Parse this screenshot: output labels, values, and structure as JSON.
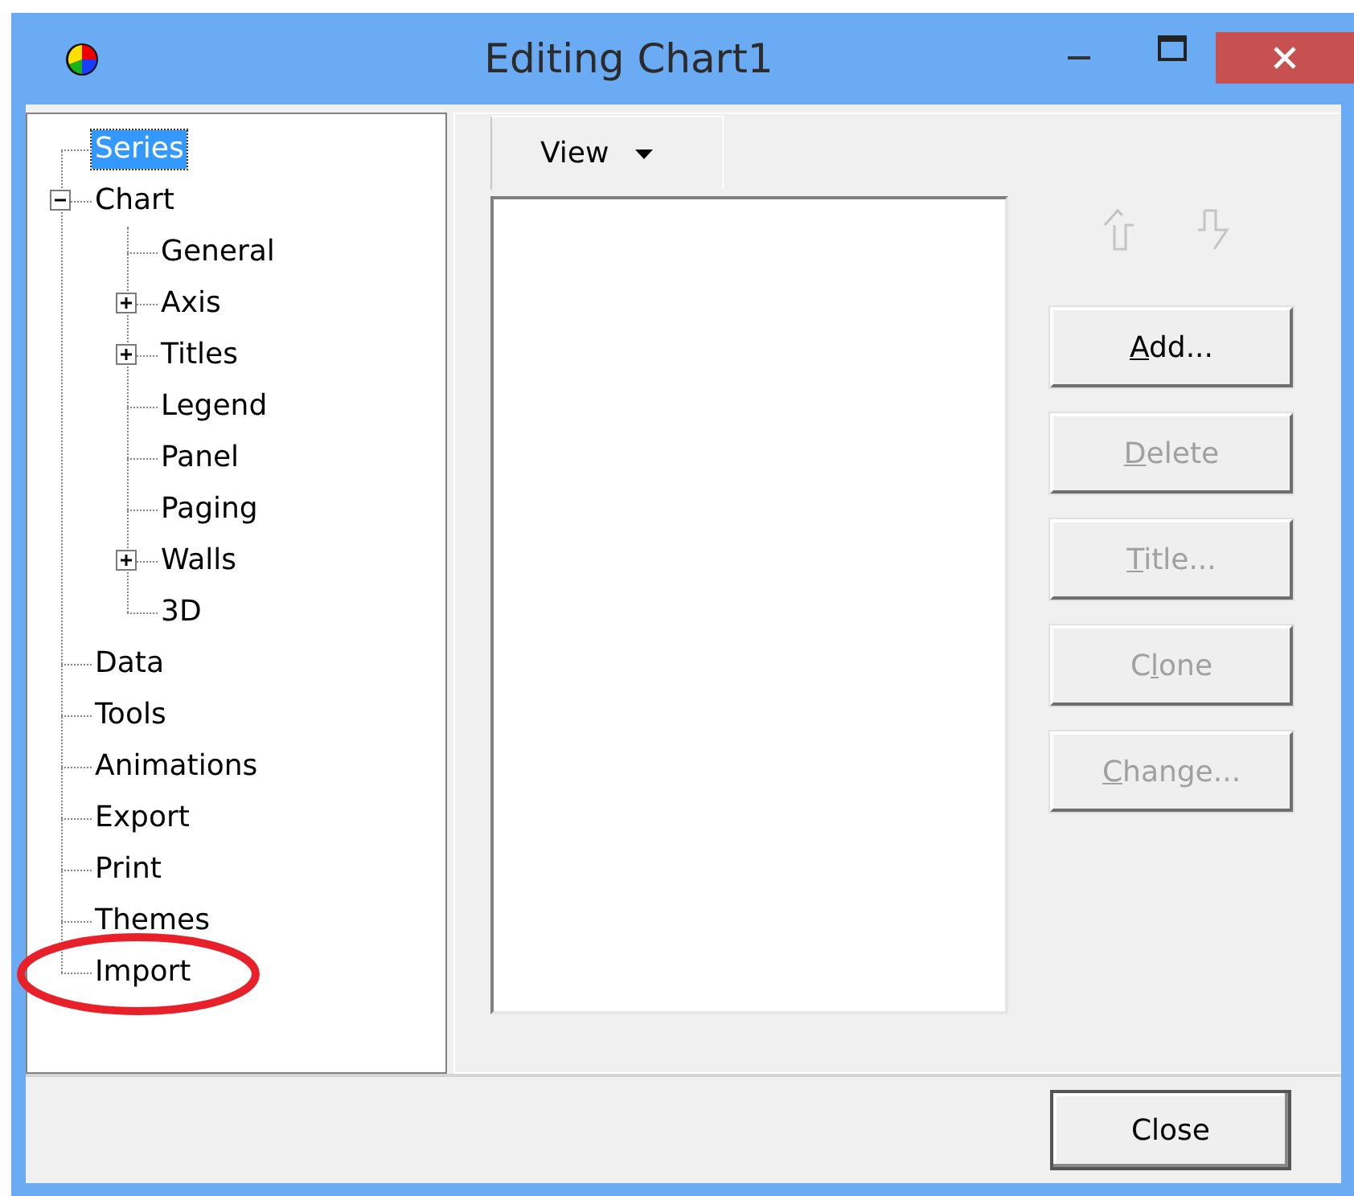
{
  "window": {
    "title": "Editing Chart1"
  },
  "tree": {
    "items": [
      {
        "label": "Series",
        "kind": "leaf",
        "selected": true
      },
      {
        "label": "Chart",
        "kind": "folder",
        "expanded": true,
        "selected": false,
        "children": [
          {
            "label": "General",
            "kind": "leaf",
            "selected": false
          },
          {
            "label": "Axis",
            "kind": "folder",
            "expanded": false,
            "selected": false
          },
          {
            "label": "Titles",
            "kind": "folder",
            "expanded": false,
            "selected": false
          },
          {
            "label": "Legend",
            "kind": "leaf",
            "selected": false
          },
          {
            "label": "Panel",
            "kind": "leaf",
            "selected": false
          },
          {
            "label": "Paging",
            "kind": "leaf",
            "selected": false
          },
          {
            "label": "Walls",
            "kind": "folder",
            "expanded": false,
            "selected": false
          },
          {
            "label": "3D",
            "kind": "leaf",
            "selected": false
          }
        ]
      },
      {
        "label": "Data",
        "kind": "leaf",
        "selected": false
      },
      {
        "label": "Tools",
        "kind": "leaf",
        "selected": false
      },
      {
        "label": "Animations",
        "kind": "leaf",
        "selected": false
      },
      {
        "label": "Export",
        "kind": "leaf",
        "selected": false
      },
      {
        "label": "Print",
        "kind": "leaf",
        "selected": false
      },
      {
        "label": "Themes",
        "kind": "leaf",
        "selected": false
      },
      {
        "label": "Import",
        "kind": "leaf",
        "selected": false,
        "highlighted": true
      }
    ]
  },
  "series_tab": {
    "label": "View"
  },
  "move_buttons": [
    {
      "kind": "up",
      "disabled": true
    },
    {
      "kind": "down",
      "disabled": true
    }
  ],
  "buttons": [
    {
      "key": "A",
      "after": "dd...",
      "disabled": false
    },
    {
      "key": "D",
      "after": "elete",
      "disabled": true
    },
    {
      "key": "T",
      "after": "itle...",
      "disabled": true
    },
    {
      "before": "C",
      "key": "l",
      "after": "one",
      "disabled": true
    },
    {
      "key": "C",
      "after": "hange...",
      "disabled": true
    }
  ],
  "close_button": {
    "label": "Close"
  }
}
